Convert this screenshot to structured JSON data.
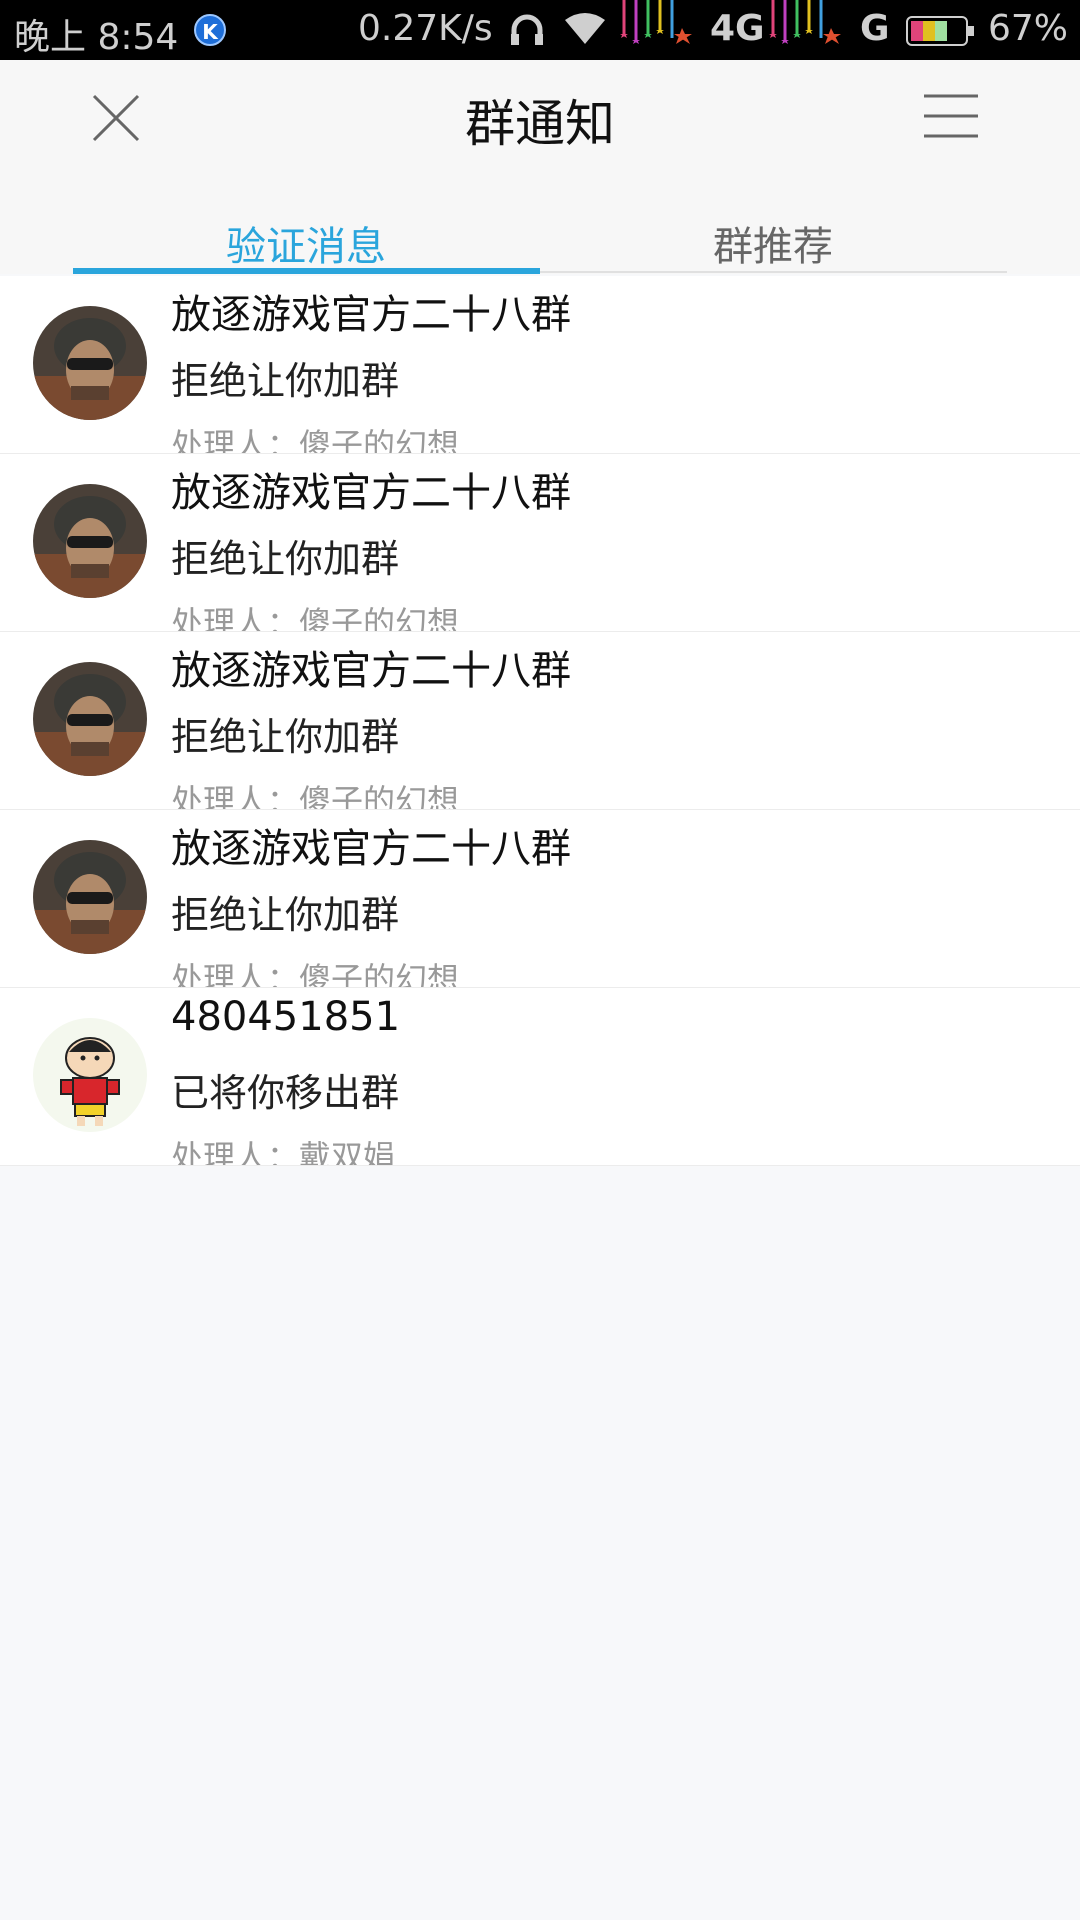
{
  "status_bar": {
    "time": "晚上 8:54",
    "speed": "0.27K/s",
    "network_1": "4G",
    "network_2": "G",
    "battery_percent": "67%",
    "icons": [
      "k-app-icon",
      "headset-icon",
      "wifi-icon",
      "signal-stars-icon",
      "battery-icon"
    ]
  },
  "header": {
    "title": "群通知",
    "close_icon": "close-icon",
    "menu_icon": "menu-icon"
  },
  "tabs": [
    {
      "label": "验证消息",
      "active": true
    },
    {
      "label": "群推荐",
      "active": false
    }
  ],
  "notifications": [
    {
      "title": "放逐游戏官方二十八群",
      "message": "拒绝让你加群",
      "handler": "处理人：傻子的幻想",
      "avatar": "soldier-avatar"
    },
    {
      "title": "放逐游戏官方二十八群",
      "message": "拒绝让你加群",
      "handler": "处理人：傻子的幻想",
      "avatar": "soldier-avatar"
    },
    {
      "title": "放逐游戏官方二十八群",
      "message": "拒绝让你加群",
      "handler": "处理人：傻子的幻想",
      "avatar": "soldier-avatar"
    },
    {
      "title": "放逐游戏官方二十八群",
      "message": "拒绝让你加群",
      "handler": "处理人：傻子的幻想",
      "avatar": "soldier-avatar"
    },
    {
      "title": "480451851",
      "message": "已将你移出群",
      "handler": "处理人：戴双娟",
      "avatar": "cartoon-boy-avatar"
    }
  ],
  "colors": {
    "accent": "#2aa5dc",
    "status_bar_bg": "#000000",
    "page_bg": "#f7f8fa"
  }
}
